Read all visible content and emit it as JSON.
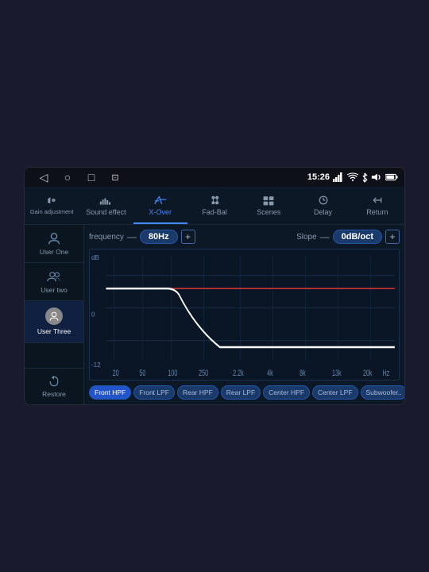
{
  "statusBar": {
    "time": "15:26",
    "icons": [
      "signal",
      "wifi",
      "bluetooth",
      "volume",
      "battery"
    ]
  },
  "navBar": {
    "backIcon": "◁",
    "homeIcon": "○",
    "recentIcon": "□",
    "screencastIcon": "⊡"
  },
  "tabs": [
    {
      "id": "gain",
      "label": "Gain adjustment",
      "icon": "gain",
      "active": false
    },
    {
      "id": "sound",
      "label": "Sound effect",
      "icon": "sound",
      "active": false
    },
    {
      "id": "xover",
      "label": "X-Over",
      "icon": "xover",
      "active": true
    },
    {
      "id": "fadbal",
      "label": "Fad-Bal",
      "icon": "fadbal",
      "active": false
    },
    {
      "id": "scenes",
      "label": "Scenes",
      "icon": "scenes",
      "active": false
    },
    {
      "id": "delay",
      "label": "Delay",
      "icon": "delay",
      "active": false
    },
    {
      "id": "return",
      "label": "Return",
      "icon": "return",
      "active": false
    }
  ],
  "sidebar": {
    "items": [
      {
        "id": "user1",
        "label": "User One",
        "icon": "user",
        "active": false
      },
      {
        "id": "user2",
        "label": "User two",
        "icon": "user",
        "active": false
      },
      {
        "id": "user3",
        "label": "User Three",
        "icon": "user-circle",
        "active": true
      }
    ],
    "restore": {
      "label": "Restore",
      "icon": "restore"
    }
  },
  "controls": {
    "frequency": {
      "label": "frequency",
      "value": "80Hz"
    },
    "slope": {
      "label": "Slope",
      "value": "0dB/oct"
    }
  },
  "graph": {
    "yLabels": [
      "dB",
      "0",
      "-12"
    ],
    "xLabels": [
      "20",
      "50",
      "100",
      "250",
      "2.2k",
      "4k",
      "8k",
      "13k",
      "20k",
      "Hz"
    ],
    "dbTopLabel": "dB",
    "db0Label": "0",
    "db12Label": "-12"
  },
  "filterButtons": [
    {
      "id": "front-hpf",
      "label": "Front HPF",
      "active": true
    },
    {
      "id": "front-lpf",
      "label": "Front LPF",
      "active": false
    },
    {
      "id": "rear-hpf",
      "label": "Rear HPF",
      "active": false
    },
    {
      "id": "rear-lpf",
      "label": "Rear LPF",
      "active": false
    },
    {
      "id": "center-hpf",
      "label": "Center HPF",
      "active": false
    },
    {
      "id": "center-lpf",
      "label": "Center LPF",
      "active": false
    },
    {
      "id": "subwoofer",
      "label": "Subwoofer..",
      "active": false
    }
  ]
}
